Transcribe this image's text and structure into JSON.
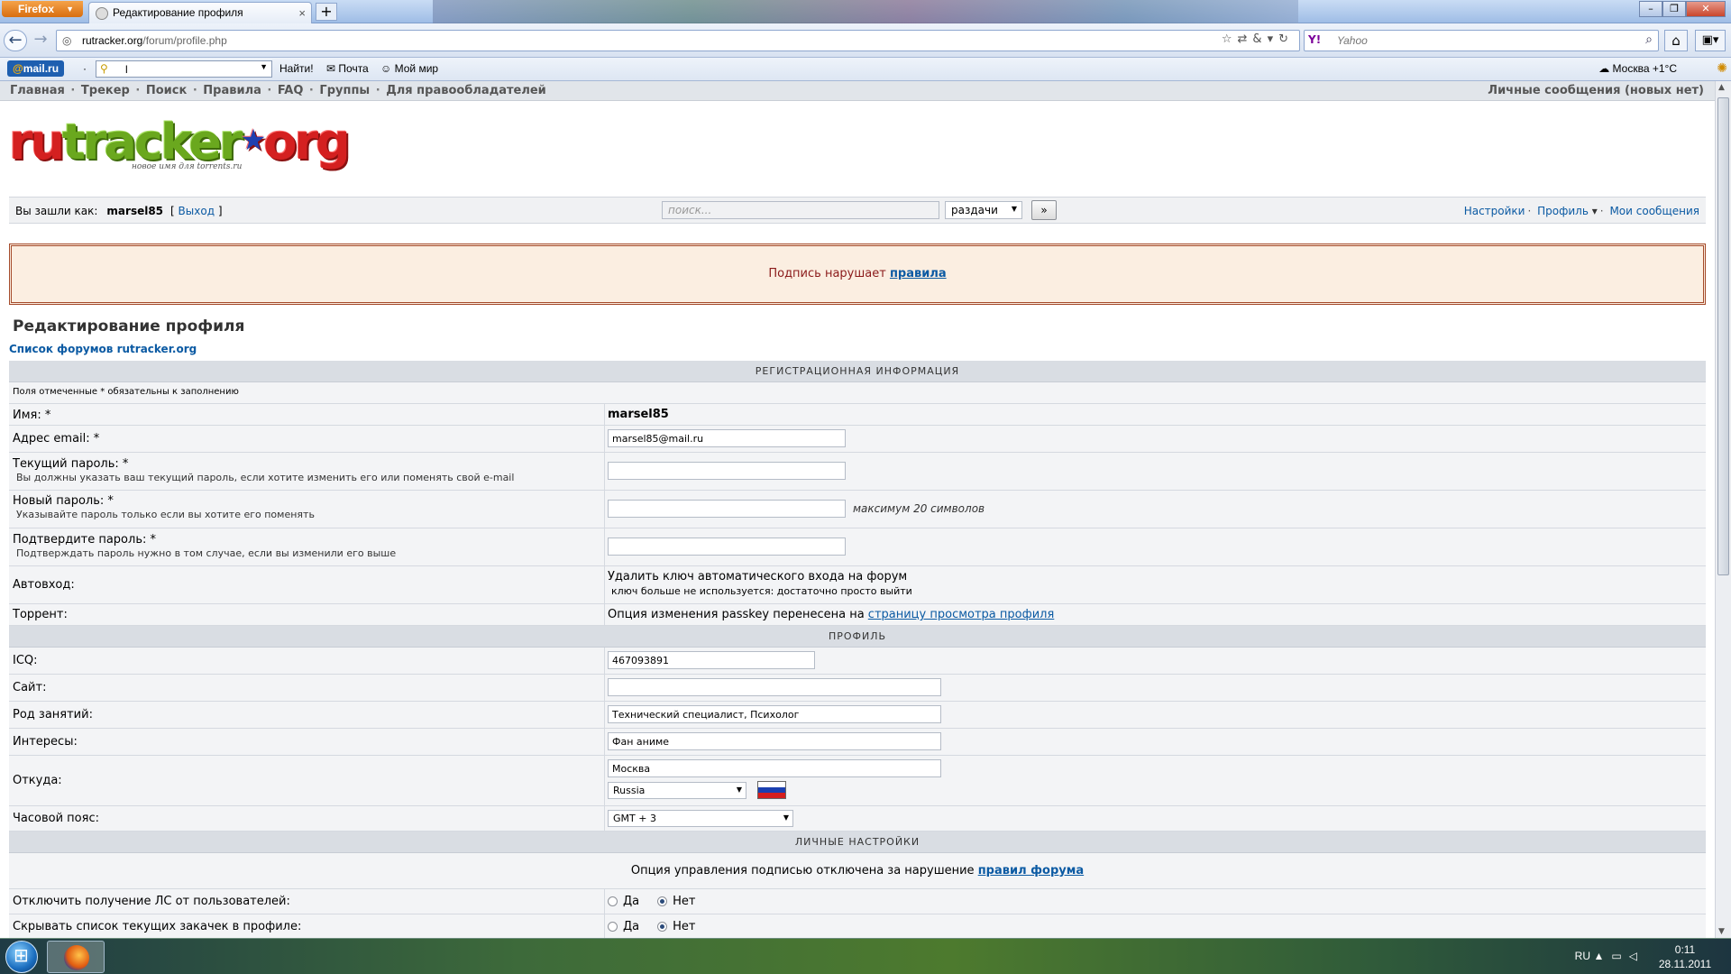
{
  "browser": {
    "menu_label": "Firefox",
    "tab_title": "Редактирование профиля",
    "url_domain": "rutracker.org",
    "url_path": "/forum/profile.php",
    "search_engine": "Y!",
    "search_placeholder": "Yahoo"
  },
  "mailru_bar": {
    "logo": "mail.ru",
    "search_value": "l",
    "find_label": "Найти!",
    "mail_label": "Почта",
    "myworld_label": "Мой мир",
    "weather": "Москва +1°C"
  },
  "site": {
    "nav": [
      "Главная",
      "Трекер",
      "Поиск",
      "Правила",
      "FAQ",
      "Группы",
      "Для правообладателей"
    ],
    "pm_link": "Личные сообщения (новых нет)",
    "logo_part1": "ru",
    "logo_part2": "tracker",
    "logo_part3": "org",
    "logo_tagline": "новое имя для torrents.ru",
    "login_prefix": "Вы зашли как:",
    "username": "marsel85",
    "logout_label": "Выход",
    "search_placeholder": "поиск...",
    "search_scope": "раздачи",
    "search_go": "»",
    "user_links": [
      "Настройки",
      "Профиль",
      "Мои сообщения"
    ]
  },
  "warning": {
    "text": "Подпись нарушает",
    "link": "правила"
  },
  "page": {
    "title": "Редактирование профиля",
    "breadcrumb": "Список форумов rutracker.org"
  },
  "form": {
    "reg_header": "РЕГИСТРАЦИОННАЯ ИНФОРМАЦИЯ",
    "required_note": "Поля отмеченные * обязательны к заполнению",
    "name_label": "Имя: *",
    "name_value": "marsel85",
    "email_label": "Адрес email: *",
    "email_value": "marsel85@mail.ru",
    "curpass_label": "Текущий пароль: *",
    "curpass_hint": "Вы должны указать ваш текущий пароль, если хотите изменить его или поменять свой e-mail",
    "newpass_label": "Новый пароль: *",
    "newpass_hint": "Указывайте пароль только если вы хотите его поменять",
    "newpass_note": "максимум 20 символов",
    "confirm_label": "Подтвердите пароль: *",
    "confirm_hint": "Подтверждать пароль нужно в том случае, если вы изменили его выше",
    "autologin_label": "Автовход:",
    "autologin_value": "Удалить ключ автоматического входа на форум",
    "autologin_hint": "ключ больше не используется: достаточно просто выйти",
    "torrent_label": "Торрент:",
    "torrent_text": "Опция изменения passkey перенесена на",
    "torrent_link": "страницу просмотра профиля",
    "profile_header": "ПРОФИЛЬ",
    "icq_label": "ICQ:",
    "icq_value": "467093891",
    "site_label": "Сайт:",
    "site_value": "",
    "occupation_label": "Род занятий:",
    "occupation_value": "Технический специалист, Психолог",
    "interests_label": "Интересы:",
    "interests_value": "Фан аниме",
    "from_label": "Откуда:",
    "from_value": "Москва",
    "country_value": "Russia",
    "timezone_label": "Часовой пояс:",
    "timezone_value": "GMT + 3",
    "personal_header": "ЛИЧНЫЕ НАСТРОЙКИ",
    "signature_text": "Опция управления подписью отключена за нарушение",
    "signature_link": "правил форума",
    "disable_pm_label": "Отключить получение ЛС от пользователей:",
    "hide_list_label": "Скрывать список текущих закачек в профиле:",
    "yes": "Да",
    "no": "Нет"
  },
  "taskbar": {
    "lang": "RU",
    "time": "0:11",
    "date": "28.11.2011"
  }
}
